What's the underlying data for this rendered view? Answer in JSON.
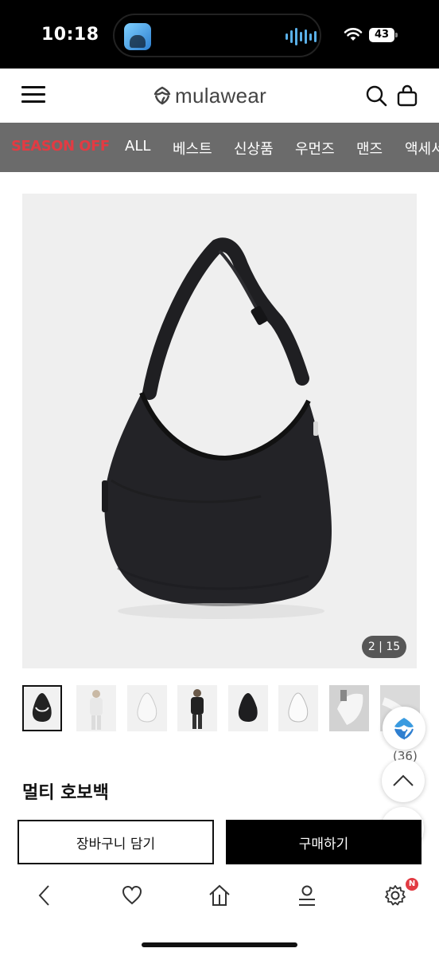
{
  "status_bar": {
    "time": "10:18",
    "battery": "43"
  },
  "header": {
    "logo_text": "mulawear"
  },
  "category_nav": {
    "items": [
      "SEASON OFF",
      "ALL",
      "베스트",
      "신상품",
      "우먼즈",
      "맨즈",
      "액세서"
    ],
    "highlight_color": "#e23b43"
  },
  "product": {
    "image_counter": "2 | 15",
    "title": "멀티 호보백",
    "thumbnail_count": 8,
    "review_count": "(36)"
  },
  "actions": {
    "add_to_cart_label": "장바구니 담기",
    "buy_label": "구매하기"
  },
  "toolbar": {
    "settings_badge": "N",
    "icons": [
      "back-icon",
      "heart-icon",
      "home-icon",
      "user-icon",
      "settings-icon"
    ]
  },
  "colors": {
    "accent_red": "#e23b43",
    "nav_bg": "#6b6b6b",
    "buy_bg": "#000000"
  }
}
